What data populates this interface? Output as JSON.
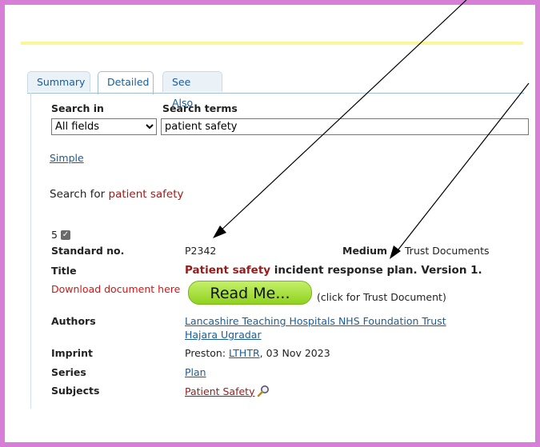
{
  "tabs": [
    {
      "label": "Summary",
      "active": false
    },
    {
      "label": "Detailed",
      "active": true
    },
    {
      "label": "See Also",
      "active": false
    }
  ],
  "search": {
    "search_in_label": "Search in",
    "search_terms_label": "Search terms",
    "field_selected": "All fields",
    "terms_value": "patient safety"
  },
  "simple_link": "Simple",
  "search_for": {
    "prefix": "Search for",
    "term": "patient safety"
  },
  "result": {
    "count": "5",
    "standard_no_label": "Standard no.",
    "standard_no": "P2342",
    "medium_label": "Medium",
    "medium": "Trust Documents",
    "title_label": "Title",
    "title_highlight": "Patient safety",
    "title_rest": " incident response plan. Version 1.",
    "download_label": "Download document here",
    "read_me_button": "Read Me...",
    "click_note": "(click for Trust Document)",
    "authors_label": "Authors",
    "authors": [
      "Lancashire Teaching Hospitals NHS Foundation Trust",
      "Hajara Ugradar"
    ],
    "imprint_label": "Imprint",
    "imprint_prefix": "Preston: ",
    "imprint_link": "LTHTR",
    "imprint_suffix": ", 03 Nov 2023",
    "series_label": "Series",
    "series": "Plan",
    "subjects_label": "Subjects",
    "subjects": "Patient Safety"
  },
  "colors": {
    "frame": "#d77fd7",
    "highlight": "#9a1a1a",
    "link": "#1a5c9a",
    "button": "#8fd21e"
  },
  "icons": {
    "subject_search": "magnifier-icon",
    "checked": "checkbox-icon"
  }
}
